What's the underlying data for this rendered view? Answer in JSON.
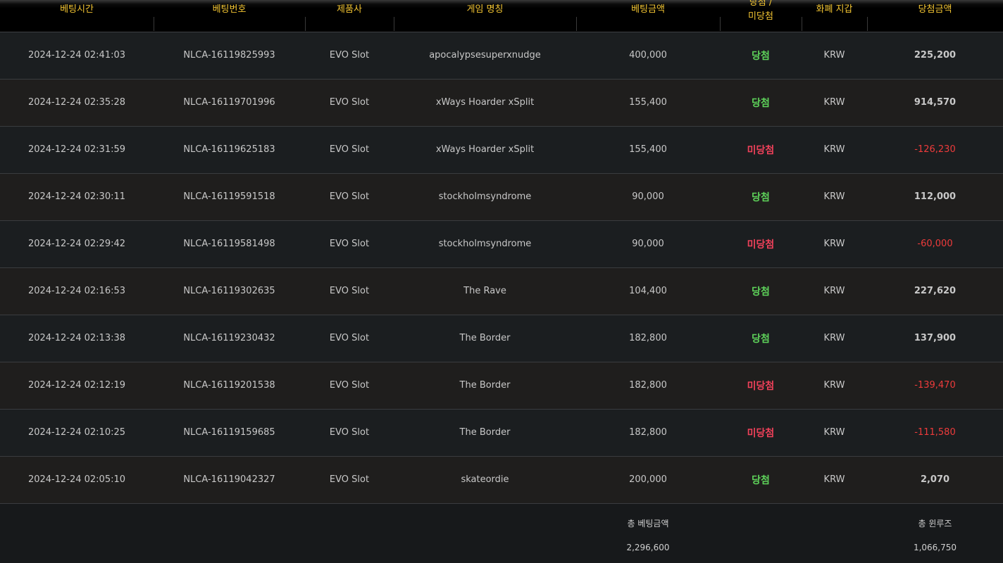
{
  "table": {
    "headers": {
      "time": "베팅시간",
      "bet_id": "베팅번호",
      "provider": "제품사",
      "game": "게임 명칭",
      "amount": "베팅금액",
      "result_line1": "당첨 /",
      "result_line2": "미당첨",
      "currency": "화폐 지갑",
      "win_amount": "당첨금액"
    },
    "rows": [
      {
        "time": "2024-12-24 02:41:03",
        "bet_id": "NLCA-16119825993",
        "provider": "EVO Slot",
        "game": "apocalypsesuperxnudge",
        "amount": "400,000",
        "result": "당첨",
        "currency": "KRW",
        "win_amount": "225,200"
      },
      {
        "time": "2024-12-24 02:35:28",
        "bet_id": "NLCA-16119701996",
        "provider": "EVO Slot",
        "game": "xWays Hoarder xSplit",
        "amount": "155,400",
        "result": "당첨",
        "currency": "KRW",
        "win_amount": "914,570"
      },
      {
        "time": "2024-12-24 02:31:59",
        "bet_id": "NLCA-16119625183",
        "provider": "EVO Slot",
        "game": "xWays Hoarder xSplit",
        "amount": "155,400",
        "result": "미당첨",
        "currency": "KRW",
        "win_amount": "-126,230"
      },
      {
        "time": "2024-12-24 02:30:11",
        "bet_id": "NLCA-16119591518",
        "provider": "EVO Slot",
        "game": "stockholmsyndrome",
        "amount": "90,000",
        "result": "당첨",
        "currency": "KRW",
        "win_amount": "112,000"
      },
      {
        "time": "2024-12-24 02:29:42",
        "bet_id": "NLCA-16119581498",
        "provider": "EVO Slot",
        "game": "stockholmsyndrome",
        "amount": "90,000",
        "result": "미당첨",
        "currency": "KRW",
        "win_amount": "-60,000"
      },
      {
        "time": "2024-12-24 02:16:53",
        "bet_id": "NLCA-16119302635",
        "provider": "EVO Slot",
        "game": "The Rave",
        "amount": "104,400",
        "result": "당첨",
        "currency": "KRW",
        "win_amount": "227,620"
      },
      {
        "time": "2024-12-24 02:13:38",
        "bet_id": "NLCA-16119230432",
        "provider": "EVO Slot",
        "game": "The Border",
        "amount": "182,800",
        "result": "당첨",
        "currency": "KRW",
        "win_amount": "137,900"
      },
      {
        "time": "2024-12-24 02:12:19",
        "bet_id": "NLCA-16119201538",
        "provider": "EVO Slot",
        "game": "The Border",
        "amount": "182,800",
        "result": "미당첨",
        "currency": "KRW",
        "win_amount": "-139,470"
      },
      {
        "time": "2024-12-24 02:10:25",
        "bet_id": "NLCA-16119159685",
        "provider": "EVO Slot",
        "game": "The Border",
        "amount": "182,800",
        "result": "미당첨",
        "currency": "KRW",
        "win_amount": "-111,580"
      },
      {
        "time": "2024-12-24 02:05:10",
        "bet_id": "NLCA-16119042327",
        "provider": "EVO Slot",
        "game": "skateordie",
        "amount": "200,000",
        "result": "당첨",
        "currency": "KRW",
        "win_amount": "2,070"
      }
    ],
    "summary": {
      "total_bet_label": "총 베팅금액",
      "total_bet_value": "2,296,600",
      "total_rolling_label": "총 윈루즈",
      "total_rolling_value": "1,066,750"
    }
  },
  "colors": {
    "header_text": "#f2c431",
    "win_text": "#5ed35a",
    "lose_text": "#f0415a",
    "negative_amount": "#ee3b3b",
    "background": "#17191b"
  }
}
